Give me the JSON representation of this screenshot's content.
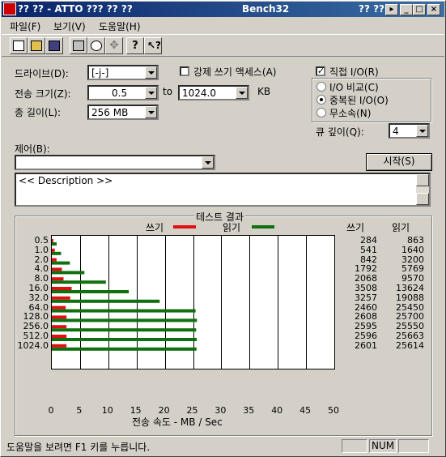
{
  "window": {
    "title": "?? ?? - ATTO ??? ?? ??",
    "center_title": "Bench32",
    "right_title": "?? ??",
    "buttons": [
      "help-arrow",
      "minimize",
      "maximize",
      "close"
    ]
  },
  "menu": [
    "파일(F)",
    "보기(V)",
    "도움말(H)"
  ],
  "toolbar_icons": [
    "new-icon",
    "open-icon",
    "save-icon",
    "print-icon",
    "print-preview-icon",
    "move-icon",
    "help-icon",
    "context-help-icon"
  ],
  "controls": {
    "drive_label": "드라이브(D):",
    "drive_value": "[-j-]",
    "transfer_label": "전송 크기(Z):",
    "transfer_from": "0.5",
    "to_label": "to",
    "transfer_to": "1024.0",
    "kb_label": "KB",
    "length_label": "총 길이(L):",
    "length_value": "256 MB",
    "force_write_label": "강제 쓰기 액세스(A)",
    "direct_io_label": "직접 I/O(R)",
    "io_compare_label": "I/O 비교(C)",
    "overlapped_io_label": "중복된 I/O(O)",
    "neither_label": "무소속(N)",
    "queue_label": "큐 깊이(Q):",
    "queue_value": "4",
    "control_label": "제어(B):",
    "control_value": "",
    "start_label": "시작(S)",
    "description": "<< Description >>"
  },
  "results": {
    "title": "테스트 결과",
    "write_legend": "쓰기",
    "read_legend": "읽기",
    "write_col": "쓰기",
    "read_col": "읽기",
    "xlabel": "전송 속도 - MB / Sec"
  },
  "colors": {
    "write": "#e01010",
    "read": "#107010"
  },
  "chart_data": {
    "type": "bar",
    "orientation": "horizontal",
    "categories": [
      "0.5",
      "1.0",
      "2.0",
      "4.0",
      "8.0",
      "16.0",
      "32.0",
      "64.0",
      "128.0",
      "256.0",
      "512.0",
      "1024.0"
    ],
    "series": [
      {
        "name": "쓰기",
        "values": [
          0.28,
          0.54,
          0.84,
          1.79,
          2.07,
          3.51,
          3.26,
          2.46,
          2.61,
          2.6,
          2.6,
          2.6
        ]
      },
      {
        "name": "읽기",
        "values": [
          0.86,
          1.64,
          3.2,
          5.77,
          9.57,
          13.62,
          19.09,
          25.45,
          25.7,
          25.55,
          25.66,
          25.61
        ]
      }
    ],
    "write_numbers": [
      "284",
      "541",
      "842",
      "1792",
      "2068",
      "3508",
      "3257",
      "2460",
      "2608",
      "2595",
      "2596",
      "2601"
    ],
    "read_numbers": [
      "863",
      "1640",
      "3200",
      "5769",
      "9570",
      "13624",
      "19088",
      "25450",
      "25700",
      "25550",
      "25663",
      "25614"
    ],
    "xticks": [
      "0",
      "5",
      "10",
      "15",
      "20",
      "25",
      "30",
      "35",
      "40",
      "45",
      "50"
    ],
    "xlim": [
      0,
      50
    ],
    "grid": true
  },
  "status": {
    "text": "도움말을 보려면 F1 키를 누릅니다.",
    "num": "NUM"
  }
}
